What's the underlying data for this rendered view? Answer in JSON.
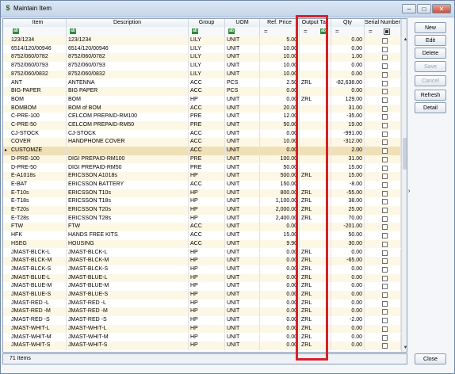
{
  "window": {
    "title": "Maintain Item",
    "minimize": "–",
    "maximize": "□",
    "close": "✕"
  },
  "columns": [
    "Item",
    "Description",
    "Group",
    "UOM",
    "Ref. Price",
    "Output Tax",
    "Qty",
    "Serial Number"
  ],
  "filter_glyphs": {
    "text": "ab",
    "equals": "="
  },
  "rows": [
    [
      "123/1234",
      "123/1234",
      "LILY",
      "UNIT",
      "5.00",
      "",
      "0.00"
    ],
    [
      "6514/120/00946",
      "6514/120/00946",
      "LILY",
      "UNIT",
      "10.00",
      "",
      "0.00"
    ],
    [
      "8752/060/0782",
      "8752/060/0782",
      "LILY",
      "UNIT",
      "10.00",
      "",
      "1.00"
    ],
    [
      "8752/060/0793",
      "8752/060/0793",
      "LILY",
      "UNIT",
      "10.00",
      "",
      "0.00"
    ],
    [
      "8752/060/0832",
      "8752/060/0832",
      "LILY",
      "UNIT",
      "10.00",
      "",
      "0.00"
    ],
    [
      "ANT",
      "ANTENNA",
      "ACC",
      "PCS",
      "2.50",
      "ZRL",
      "-82,638.00"
    ],
    [
      "BIG-PAPER",
      "BIG PAPER",
      "ACC",
      "PCS",
      "0.00",
      "",
      "0.00"
    ],
    [
      "BOM",
      "BOM",
      "HP",
      "UNIT",
      "0.00",
      "ZRL",
      "129.00"
    ],
    [
      "BOMBOM",
      "BOM of BOM",
      "ACC",
      "UNIT",
      "20.00",
      "",
      "31.00"
    ],
    [
      "C-PRE-100",
      "CELCOM PREPAID-RM100",
      "PRE",
      "UNIT",
      "12.00",
      "",
      "-35.00"
    ],
    [
      "C-PRE-50",
      "CELCOM PREPAID-RM50",
      "PRE",
      "UNIT",
      "50.00",
      "",
      "19.00"
    ],
    [
      "CJ-STOCK",
      "CJ-STOCK",
      "ACC",
      "UNIT",
      "0.00",
      "",
      "-991.00"
    ],
    [
      "COVER",
      "HANDPHONE COVER",
      "ACC",
      "UNIT",
      "10.00",
      "",
      "-312.00"
    ],
    [
      "CUSTOMZE",
      "",
      "ACC",
      "UNIT",
      "0.00",
      "",
      "2.00"
    ],
    [
      "D-PRE-100",
      "DIGI PREPAID-RM100",
      "PRE",
      "UNIT",
      "100.00",
      "",
      "31.00"
    ],
    [
      "D-PRE-50",
      "DIGI PREPAID-RM50",
      "PRE",
      "UNIT",
      "50.00",
      "",
      "15.00"
    ],
    [
      "E-A1018s",
      "ERICSSON A1018s",
      "HP",
      "UNIT",
      "500.00",
      "ZRL",
      "15.00"
    ],
    [
      "E-BAT",
      "ERICSSON BATTERY",
      "ACC",
      "UNIT",
      "150.00",
      "",
      "-8.00"
    ],
    [
      "E-T10s",
      "ERICSSON T10s",
      "HP",
      "UNIT",
      "800.00",
      "ZRL",
      "-55.00"
    ],
    [
      "E-T18s",
      "ERICSSON T18s",
      "HP",
      "UNIT",
      "1,100.00",
      "ZRL",
      "38.00"
    ],
    [
      "E-T20s",
      "ERICSSON T20s",
      "HP",
      "UNIT",
      "2,000.00",
      "ZRL",
      "25.00"
    ],
    [
      "E-T28s",
      "ERICSSON T28s",
      "HP",
      "UNIT",
      "2,400.00",
      "ZRL",
      "70.00"
    ],
    [
      "FTW",
      "FTW",
      "ACC",
      "UNIT",
      "0.00",
      "",
      "-201.00"
    ],
    [
      "HFK",
      "HANDS FREE KITS",
      "ACC",
      "UNIT",
      "15.00",
      "",
      "50.00"
    ],
    [
      "HSEG",
      "HOUSING",
      "ACC",
      "UNIT",
      "9.90",
      "",
      "30.00"
    ],
    [
      "JMAST-BLCK-L",
      "JMAST-BLCK-L",
      "HP",
      "UNIT",
      "0.00",
      "ZRL",
      "0.00"
    ],
    [
      "JMAST-BLCK-M",
      "JMAST-BLCK-M",
      "HP",
      "UNIT",
      "0.00",
      "ZRL",
      "-65.00"
    ],
    [
      "JMAST-BLCK-S",
      "JMAST-BLCK-S",
      "HP",
      "UNIT",
      "0.00",
      "ZRL",
      "0.00"
    ],
    [
      "JMAST-BLUE-L",
      "JMAST-BLUE-L",
      "HP",
      "UNIT",
      "0.00",
      "ZRL",
      "0.00"
    ],
    [
      "JMAST-BLUE-M",
      "JMAST-BLUE-M",
      "HP",
      "UNIT",
      "0.00",
      "ZRL",
      "0.00"
    ],
    [
      "JMAST-BLUE-S",
      "JMAST-BLUE-S",
      "HP",
      "UNIT",
      "0.00",
      "ZRL",
      "0.00"
    ],
    [
      "JMAST-RED -L",
      "JMAST-RED -L",
      "HP",
      "UNIT",
      "0.00",
      "ZRL",
      "0.00"
    ],
    [
      "JMAST-RED -M",
      "JMAST-RED -M",
      "HP",
      "UNIT",
      "0.00",
      "ZRL",
      "0.00"
    ],
    [
      "JMAST-RED -S",
      "JMAST-RED -S",
      "HP",
      "UNIT",
      "0.00",
      "ZRL",
      "-2.00"
    ],
    [
      "JMAST-WHIT-L",
      "JMAST-WHIT-L",
      "HP",
      "UNIT",
      "0.00",
      "ZRL",
      "0.00"
    ],
    [
      "JMAST-WHIT-M",
      "JMAST-WHIT-M",
      "HP",
      "UNIT",
      "0.00",
      "ZRL",
      "0.00"
    ],
    [
      "JMAST-WHIT-S",
      "JMAST-WHIT-S",
      "HP",
      "UNIT",
      "0.00",
      "ZRL",
      "0.00"
    ]
  ],
  "selected_row": 13,
  "status": {
    "count": "71 Items"
  },
  "buttons": [
    "New",
    "Edit",
    "Delete",
    "Save",
    "Cancel",
    "Refresh",
    "Detail"
  ],
  "disabled_buttons": [
    "Save",
    "Cancel"
  ],
  "close_label": "Close",
  "splitter_arrow": "›",
  "row_pointer": "▸",
  "colors": {
    "highlight": "#d8202a",
    "row_alt": "#fdf7e6",
    "row_selected": "#efe0b8"
  }
}
